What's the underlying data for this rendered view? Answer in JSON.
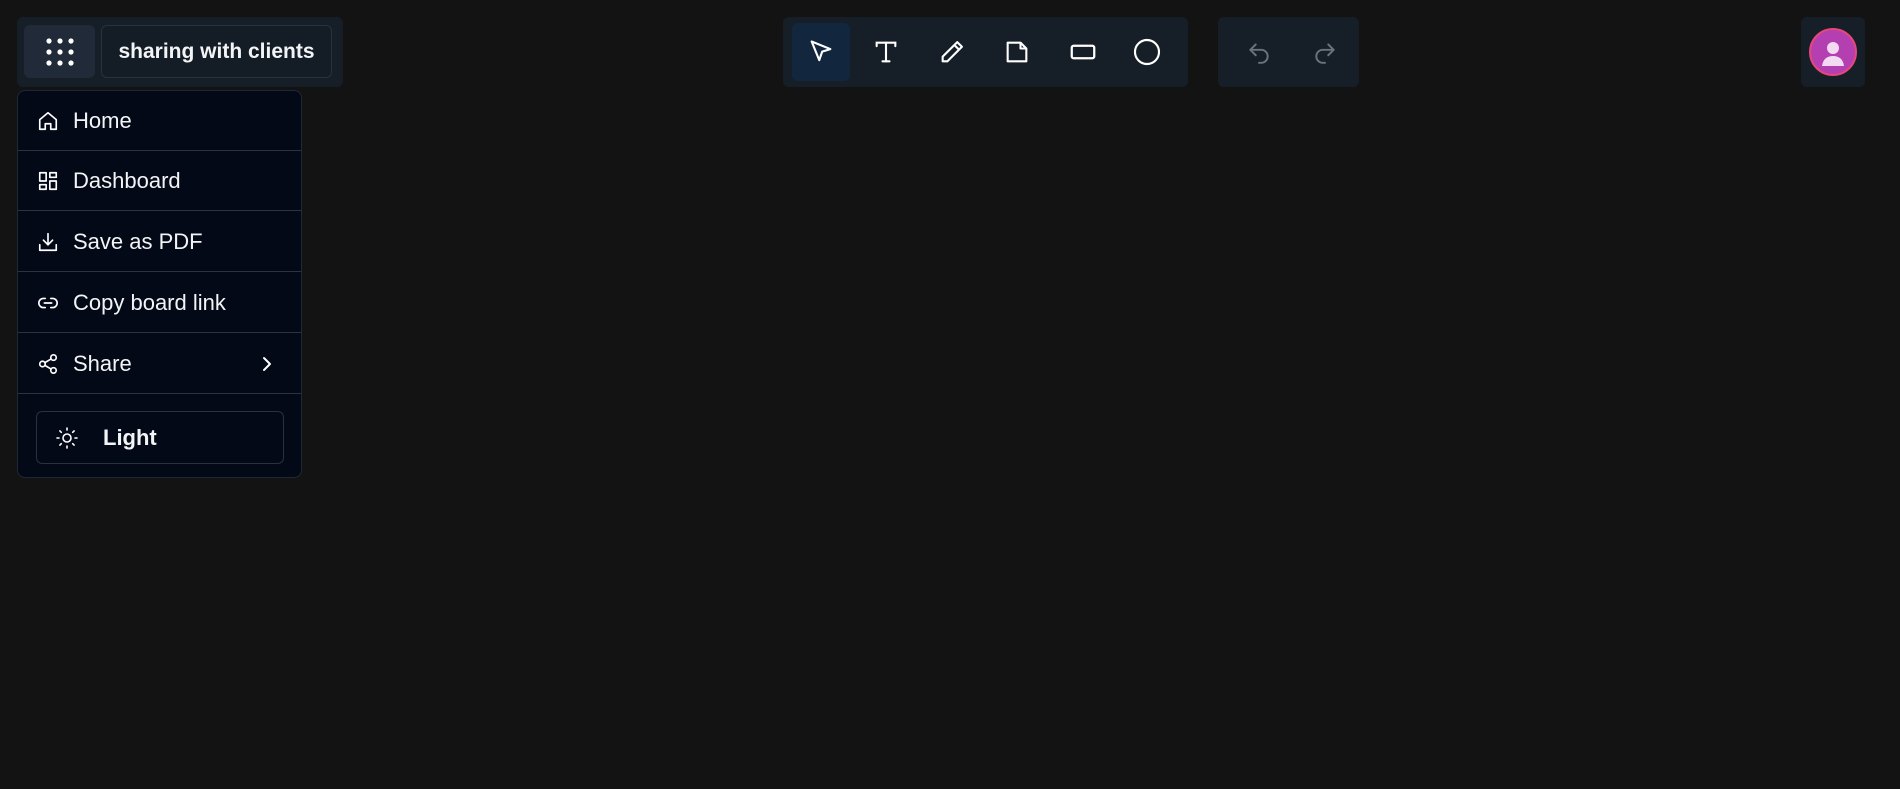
{
  "board": {
    "title": "sharing with clients"
  },
  "menu": {
    "items": [
      {
        "label": "Home",
        "icon": "home-icon"
      },
      {
        "label": "Dashboard",
        "icon": "dashboard-icon"
      },
      {
        "label": "Save as PDF",
        "icon": "download-icon"
      },
      {
        "label": "Copy board link",
        "icon": "link-icon"
      },
      {
        "label": "Share",
        "icon": "share-icon"
      }
    ],
    "theme_label": "Light"
  },
  "toolbar": {
    "tools": [
      {
        "name": "select",
        "icon": "cursor-icon",
        "active": true
      },
      {
        "name": "text",
        "icon": "text-icon",
        "active": false
      },
      {
        "name": "pen",
        "icon": "pencil-icon",
        "active": false
      },
      {
        "name": "sticky-note",
        "icon": "note-icon",
        "active": false
      },
      {
        "name": "rectangle",
        "icon": "rectangle-icon",
        "active": false
      },
      {
        "name": "circle",
        "icon": "circle-icon",
        "active": false
      }
    ],
    "history": [
      {
        "name": "undo",
        "icon": "undo-icon"
      },
      {
        "name": "redo",
        "icon": "redo-icon"
      }
    ]
  },
  "user": {
    "avatar_icon": "user-icon"
  },
  "colors": {
    "background": "#131313",
    "panel": "#161e27",
    "menu_bg": "#030917",
    "active_tool": "#12273d",
    "avatar": "#b43fb1",
    "avatar_ring": "#e5477a"
  }
}
